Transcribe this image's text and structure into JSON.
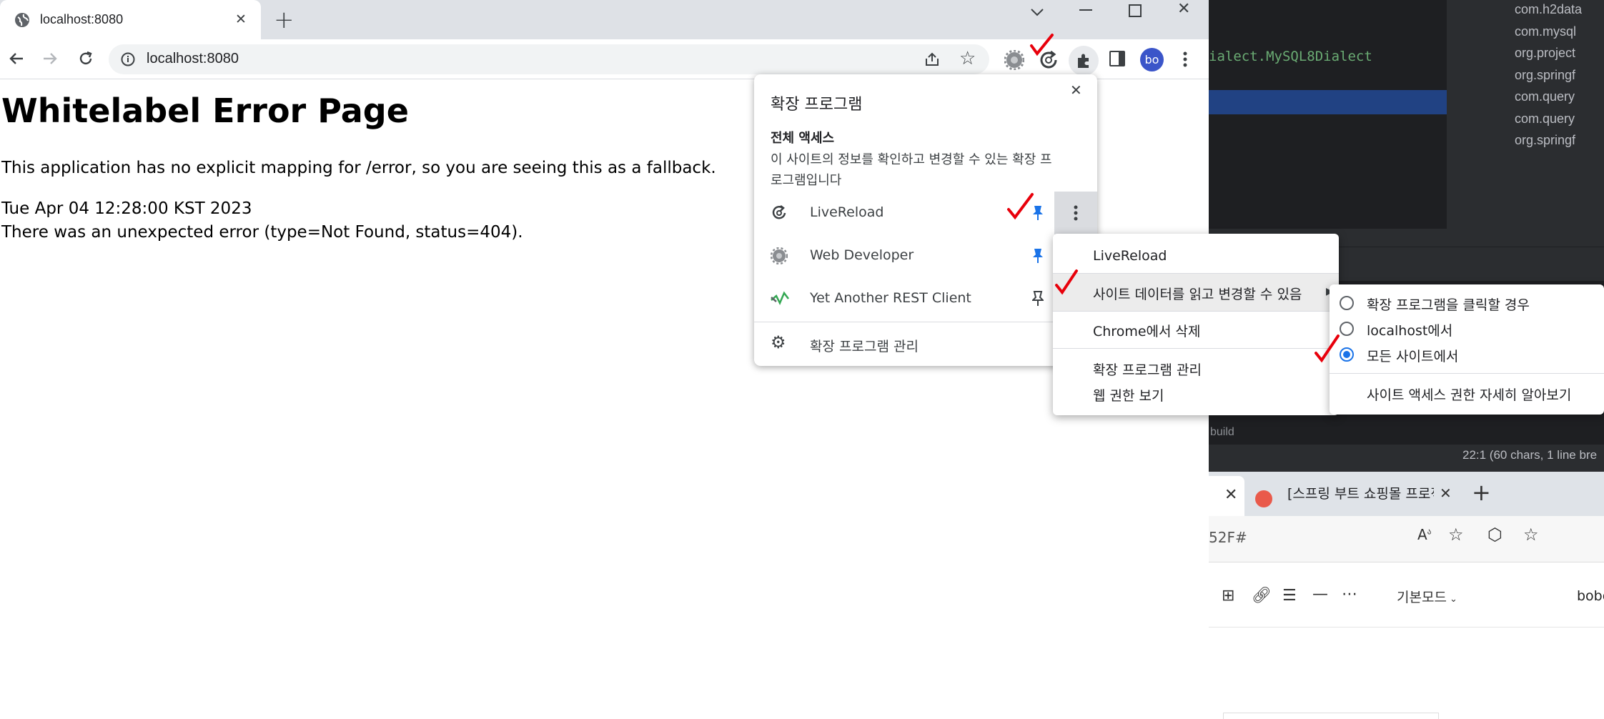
{
  "browser": {
    "tab_title": "localhost:8080",
    "url": "localhost:8080",
    "profile_initials": "bo"
  },
  "page": {
    "title": "Whitelabel Error Page",
    "message": "This application has no explicit mapping for /error, so you are seeing this as a fallback.",
    "timestamp": "Tue Apr 04 12:28:00 KST 2023",
    "error": "There was an unexpected error (type=Not Found, status=404)."
  },
  "extensions_popup": {
    "title": "확장 프로그램",
    "section_title": "전체 액세스",
    "section_desc_1": "이 사이트의 정보를 확인하고 변경할 수 있는 확장 프",
    "section_desc_2": "로그램입니다",
    "items": [
      {
        "name": "LiveReload",
        "pinned": true
      },
      {
        "name": "Web Developer",
        "pinned": true
      },
      {
        "name": "Yet Another REST Client",
        "pinned": false
      }
    ],
    "manage_label": "확장 프로그램 관리"
  },
  "context_menu": {
    "header": "LiveReload",
    "site_data": "사이트 데이터를 읽고 변경할 수 있음",
    "remove": "Chrome에서 삭제",
    "manage": "확장 프로그램 관리",
    "permissions": "웹 권한 보기"
  },
  "submenu": {
    "options": [
      {
        "label": "확장 프로그램을 클릭할 경우",
        "selected": false
      },
      {
        "label": "localhost에서",
        "selected": false
      },
      {
        "label": "모든 사이트에서",
        "selected": true
      }
    ],
    "learn_more": "사이트 액세스 권한 자세히 알아보기"
  },
  "ide": {
    "code_fragment": "ialect.MySQL8Dialect",
    "tree_items": [
      "com.h2data",
      "com.mysql",
      "org.project",
      "org.springf",
      "com.query",
      "com.query",
      "org.springf"
    ],
    "console_fragment": "build",
    "status_text": "22:1 (60 chars, 1 line bre"
  },
  "edge": {
    "tab_title": "[스프링 부트 쇼핑몰 프로젝트 wi",
    "url_fragment": "52F#",
    "mode_label": "기본모드",
    "user_fragment": "bobo"
  },
  "colors": {
    "accent": "#1a73e8",
    "annotation": "#e8000b",
    "tabstrip": "#dee1e6",
    "ide_bg": "#2b2d30"
  }
}
